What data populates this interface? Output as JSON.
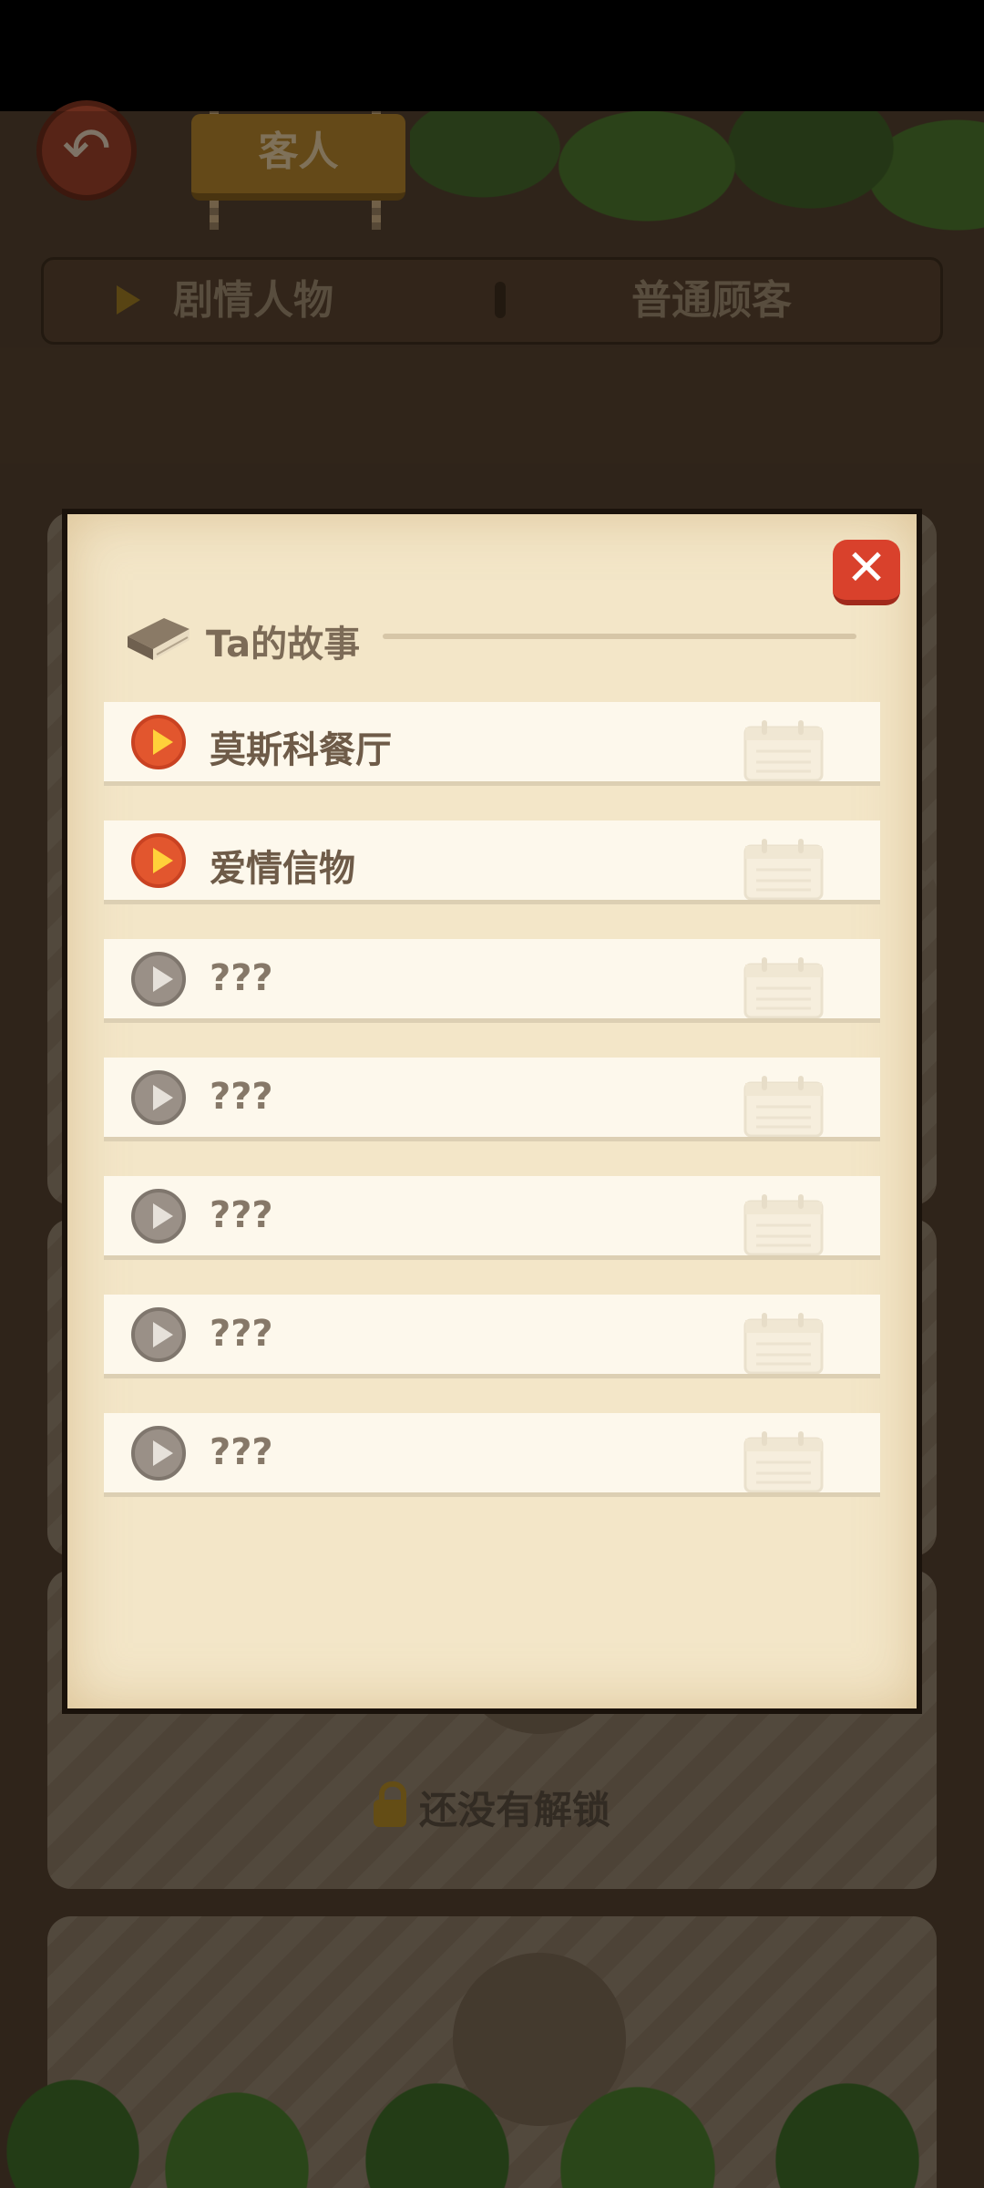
{
  "header": {
    "title": "客人",
    "back_icon": "back-arrow-icon"
  },
  "tabs": [
    {
      "label": "剧情人物",
      "selected": true
    },
    {
      "label": "普通顾客",
      "selected": false
    }
  ],
  "background": {
    "locked_text": "还没有解锁"
  },
  "modal": {
    "title": "Ta的故事",
    "close_icon": "close-x-icon",
    "stories": [
      {
        "label": "莫斯科餐厅",
        "unlocked": true
      },
      {
        "label": "爱情信物",
        "unlocked": true
      },
      {
        "label": "???",
        "unlocked": false
      },
      {
        "label": "???",
        "unlocked": false
      },
      {
        "label": "???",
        "unlocked": false
      },
      {
        "label": "???",
        "unlocked": false
      },
      {
        "label": "???",
        "unlocked": false
      }
    ]
  },
  "colors": {
    "accent": "#e2562e",
    "close": "#d9412c",
    "paper": "#f3e6c8"
  }
}
